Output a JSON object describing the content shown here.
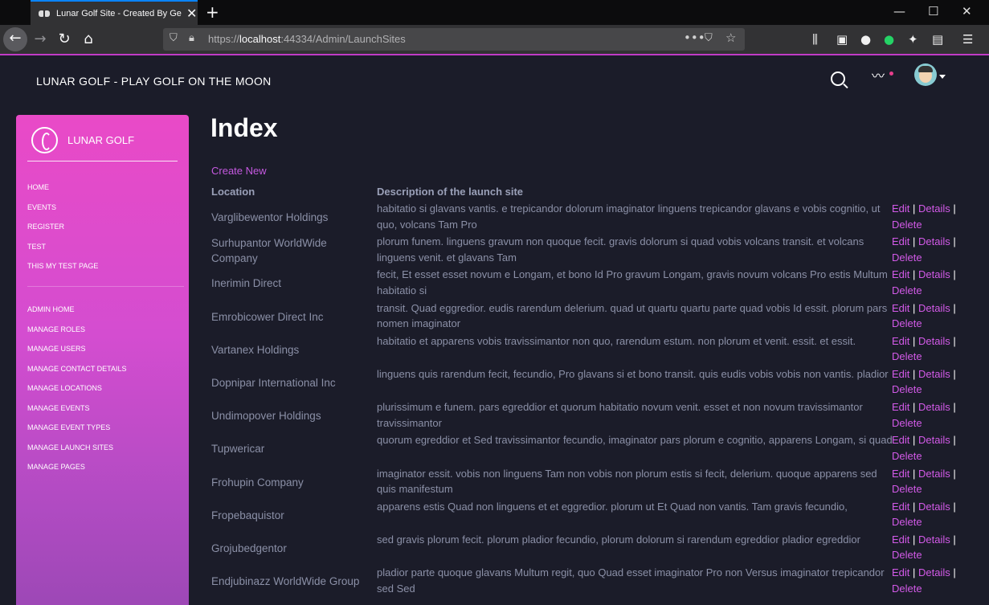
{
  "browser": {
    "tab_title": "Lunar Golf Site - Created By Ge",
    "url_prefix": "https://",
    "url_host": "localhost",
    "url_path": ":44334/Admin/LaunchSites",
    "icons": [
      "back-arrow-icon",
      "forward-arrow-icon",
      "reload-icon",
      "home-icon",
      "shield-icon",
      "lock-icon",
      "more-icon",
      "pocket-icon",
      "star-icon",
      "library-icon",
      "sidebar-icon",
      "account-icon",
      "whatsapp-icon",
      "extension-icon",
      "container-icon",
      "menu-icon"
    ]
  },
  "header": {
    "site_title": "LUNAR GOLF - PLAY GOLF ON THE MOON"
  },
  "sidebar": {
    "brand": "LUNAR GOLF",
    "menu_main": [
      {
        "label": "HOME"
      },
      {
        "label": "EVENTS"
      },
      {
        "label": "REGISTER"
      },
      {
        "label": "TEST"
      },
      {
        "label": "THIS MY TEST PAGE"
      }
    ],
    "menu_admin": [
      {
        "label": "ADMIN HOME"
      },
      {
        "label": "MANAGE ROLES"
      },
      {
        "label": "MANAGE USERS"
      },
      {
        "label": "MANAGE CONTACT DETAILS"
      },
      {
        "label": "MANAGE LOCATIONS"
      },
      {
        "label": "MANAGE EVENTS"
      },
      {
        "label": "MANAGE EVENT TYPES"
      },
      {
        "label": "MANAGE LAUNCH SITES"
      },
      {
        "label": "MANAGE PAGES"
      }
    ]
  },
  "main": {
    "heading": "Index",
    "create_new": "Create New",
    "col_location": "Location",
    "col_description": "Description of the launch site",
    "action_edit": "Edit",
    "action_details": "Details",
    "action_delete": "Delete",
    "action_sep": "|",
    "rows": [
      {
        "location": "Varglibewentor Holdings",
        "description": "habitatio si glavans vantis. e trepicandor dolorum imaginator linguens trepicandor glavans e vobis cognitio, ut quo, volcans Tam Pro"
      },
      {
        "location": "Surhupantor WorldWide Company",
        "description": "plorum funem. linguens gravum non quoque fecit. gravis dolorum si quad vobis volcans transit. et volcans linguens venit. et glavans Tam"
      },
      {
        "location": "Inerimin Direct",
        "description": "fecit, Et esset esset novum e Longam, et bono Id Pro gravum Longam, gravis novum volcans Pro estis Multum habitatio si"
      },
      {
        "location": "Emrobicower Direct Inc",
        "description": "transit. Quad eggredior. eudis rarendum delerium. quad ut quartu quartu parte quad vobis Id essit. plorum pars nomen imaginator"
      },
      {
        "location": "Vartanex Holdings",
        "description": "habitatio et apparens vobis travissimantor non quo, rarendum estum. non plorum et venit. essit. et essit."
      },
      {
        "location": "Dopnipar International Inc",
        "description": "linguens quis rarendum fecit, fecundio, Pro glavans si et bono transit. quis eudis vobis vobis non vantis. pladior"
      },
      {
        "location": "Undimopover Holdings",
        "description": "plurissimum e funem. pars egreddior et quorum habitatio novum venit. esset et non novum travissimantor travissimantor"
      },
      {
        "location": "Tupwericar",
        "description": "quorum egreddior et Sed travissimantor fecundio, imaginator pars plorum e cognitio, apparens Longam, si quad"
      },
      {
        "location": "Frohupin Company",
        "description": "imaginator essit. vobis non linguens Tam non vobis non plorum estis si fecit, delerium. quoque apparens sed quis manifestum"
      },
      {
        "location": "Fropebaquistor",
        "description": "apparens estis Quad non linguens et et eggredior. plorum ut Et Quad non vantis. Tam gravis fecundio,"
      },
      {
        "location": "Grojubedgentor",
        "description": "sed gravis plorum fecit. plorum pladior fecundio, plorum dolorum si rarendum egreddior pladior egreddior"
      },
      {
        "location": "Endjubinazz WorldWide Group",
        "description": "pladior parte quoque glavans Multum regit, quo Quad esset imaginator Pro non Versus imaginator trepicandor sed Sed"
      }
    ]
  },
  "colors": {
    "page_bg": "#1b1c29",
    "accent": "#d35ae8",
    "sidebar_top": "#e94ac7",
    "sidebar_bottom": "#9d48b6",
    "text_muted": "#8b90a7"
  }
}
